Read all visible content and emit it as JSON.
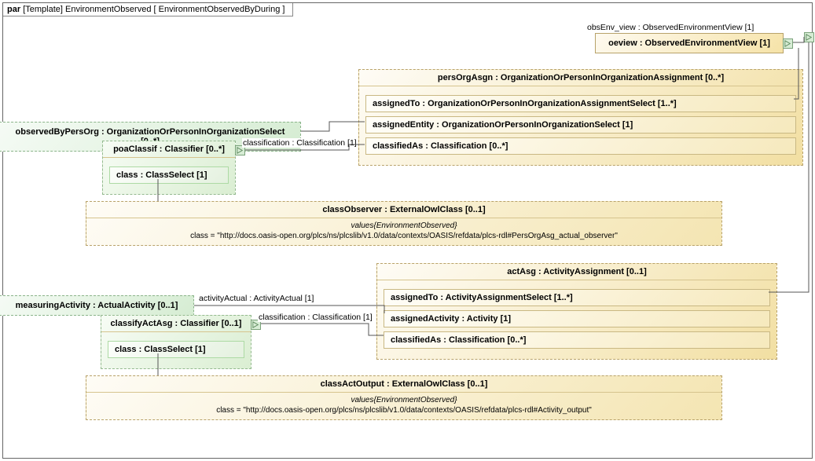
{
  "frame": {
    "kind": "par",
    "group": "[Template]",
    "name": "EnvironmentObserved",
    "spec": "[ EnvironmentObservedByDuring ]"
  },
  "obsEnvLabel": "obsEnv_view : ObservedEnvironmentView [1]",
  "oeview": "oeview : ObservedEnvironmentView [1]",
  "observedByPersOrg": "observedByPersOrg : OrganizationOrPersonInOrganizationSelect [0..*]",
  "persOrgAsgn": {
    "title": "persOrgAsgn : OrganizationOrPersonInOrganizationAssignment [0..*]",
    "rows": {
      "assignedTo": "assignedTo : OrganizationOrPersonInOrganizationAssignmentSelect [1..*]",
      "assignedEntity": "assignedEntity : OrganizationOrPersonInOrganizationSelect [1]",
      "classifiedAs": "classifiedAs : Classification [0..*]"
    }
  },
  "poaClassif": {
    "title": "poaClassif : Classifier [0..*]",
    "class": "class : ClassSelect [1]"
  },
  "classifLabel1": "classification : Classification [1]",
  "classObserver": {
    "title": "classObserver : ExternalOwlClass [0..1]",
    "tag": "values{EnvironmentObserved}",
    "value": "class = \"http://docs.oasis-open.org/plcs/ns/plcslib/v1.0/data/contexts/OASIS/refdata/plcs-rdl#PersOrgAsg_actual_observer\""
  },
  "measuringActivity": "measuringActivity : ActualActivity [0..1]",
  "activityActualLabel": "activityActual : ActivityActual [1]",
  "actAsg": {
    "title": "actAsg : ActivityAssignment [0..1]",
    "rows": {
      "assignedTo": "assignedTo : ActivityAssignmentSelect [1..*]",
      "assignedActivity": "assignedActivity : Activity [1]",
      "classifiedAs": "classifiedAs : Classification [0..*]"
    }
  },
  "classifyActAsg": {
    "title": "classifyActAsg : Classifier [0..1]",
    "class": "class : ClassSelect [1]"
  },
  "classifLabel2": "classification : Classification [1]",
  "classActOutput": {
    "title": "classActOutput : ExternalOwlClass [0..1]",
    "tag": "values{EnvironmentObserved}",
    "value": "class = \"http://docs.oasis-open.org/plcs/ns/plcslib/v1.0/data/contexts/OASIS/refdata/plcs-rdl#Activity_output\""
  },
  "chart_data": {
    "type": "diagram",
    "description": "SysML parametric (par) diagram template EnvironmentObserved / EnvironmentObservedByDuring",
    "blocks": [
      {
        "id": "oeview",
        "name": "oeview",
        "type": "ObservedEnvironmentView",
        "multiplicity": "[1]"
      },
      {
        "id": "observedByPersOrg",
        "name": "observedByPersOrg",
        "type": "OrganizationOrPersonInOrganizationSelect",
        "multiplicity": "[0..*]"
      },
      {
        "id": "persOrgAsgn",
        "name": "persOrgAsgn",
        "type": "OrganizationOrPersonInOrganizationAssignment",
        "multiplicity": "[0..*]",
        "rows": [
          {
            "name": "assignedTo",
            "type": "OrganizationOrPersonInOrganizationAssignmentSelect",
            "multiplicity": "[1..*]"
          },
          {
            "name": "assignedEntity",
            "type": "OrganizationOrPersonInOrganizationSelect",
            "multiplicity": "[1]"
          },
          {
            "name": "classifiedAs",
            "type": "Classification",
            "multiplicity": "[0..*]"
          }
        ]
      },
      {
        "id": "poaClassif",
        "name": "poaClassif",
        "type": "Classifier",
        "multiplicity": "[0..*]",
        "rows": [
          {
            "name": "class",
            "type": "ClassSelect",
            "multiplicity": "[1]"
          }
        ]
      },
      {
        "id": "classObserver",
        "name": "classObserver",
        "type": "ExternalOwlClass",
        "multiplicity": "[0..1]",
        "values": {
          "class": "http://docs.oasis-open.org/plcs/ns/plcslib/v1.0/data/contexts/OASIS/refdata/plcs-rdl#PersOrgAsg_actual_observer"
        }
      },
      {
        "id": "measuringActivity",
        "name": "measuringActivity",
        "type": "ActualActivity",
        "multiplicity": "[0..1]"
      },
      {
        "id": "actAsg",
        "name": "actAsg",
        "type": "ActivityAssignment",
        "multiplicity": "[0..1]",
        "rows": [
          {
            "name": "assignedTo",
            "type": "ActivityAssignmentSelect",
            "multiplicity": "[1..*]"
          },
          {
            "name": "assignedActivity",
            "type": "Activity",
            "multiplicity": "[1]"
          },
          {
            "name": "classifiedAs",
            "type": "Classification",
            "multiplicity": "[0..*]"
          }
        ]
      },
      {
        "id": "classifyActAsg",
        "name": "classifyActAsg",
        "type": "Classifier",
        "multiplicity": "[0..1]",
        "rows": [
          {
            "name": "class",
            "type": "ClassSelect",
            "multiplicity": "[1]"
          }
        ]
      },
      {
        "id": "classActOutput",
        "name": "classActOutput",
        "type": "ExternalOwlClass",
        "multiplicity": "[0..1]",
        "values": {
          "class": "http://docs.oasis-open.org/plcs/ns/plcslib/v1.0/data/contexts/OASIS/refdata/plcs-rdl#Activity_output"
        }
      }
    ],
    "external_port": {
      "name": "obsEnv_view",
      "type": "ObservedEnvironmentView",
      "multiplicity": "[1]"
    },
    "connectors": [
      {
        "from": "oeview",
        "to": "external:obsEnv_view"
      },
      {
        "from": "oeview",
        "to": "persOrgAsgn.assignedTo"
      },
      {
        "from": "oeview",
        "to": "actAsg.assignedTo"
      },
      {
        "from": "observedByPersOrg",
        "to": "persOrgAsgn.assignedEntity"
      },
      {
        "from": "poaClassif",
        "to": "persOrgAsgn.classifiedAs",
        "label": "classification : Classification [1]"
      },
      {
        "from": "poaClassif.class",
        "to": "classObserver"
      },
      {
        "from": "measuringActivity",
        "to": "actAsg.assignedActivity",
        "label": "activityActual : ActivityActual [1]"
      },
      {
        "from": "classifyActAsg",
        "to": "actAsg.classifiedAs",
        "label": "classification : Classification [1]"
      },
      {
        "from": "classifyActAsg.class",
        "to": "classActOutput"
      }
    ]
  }
}
